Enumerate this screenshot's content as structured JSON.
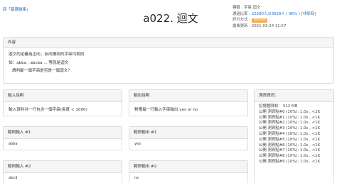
{
  "breadcrumb": {
    "link": "回「基礎題庫」"
  },
  "problem": {
    "title": "a022. 迴文"
  },
  "meta": {
    "tags_label": "標籤 : ",
    "tags_value": "字串 迴文",
    "pass_label": "通過比率 : ",
    "pass_value": "22580人/23628人 ( 96% ) [非即時]",
    "score_label": "評分方式 : ",
    "score_value": "Tolerant",
    "updated_label": "最後更新 : ",
    "updated_value": "2021-03-24 11:57"
  },
  "content": {
    "heading": "內容",
    "lines": [
      "迴文的定義為正向，反向讀到的字串均相同",
      "如：abba , abcba ... 等就是迴文",
      "請判斷一個字串是否是一個迴文？"
    ]
  },
  "input_desc": {
    "heading": "輸入說明",
    "text": "輸入資料共一行包含一個字串(長度 < 1000)"
  },
  "output_desc": {
    "heading": "輸出說明",
    "text": "對應每一行輸入字串輸出 yes or no"
  },
  "sample_input_1": {
    "heading": "範例輸入 #1",
    "text": "abba"
  },
  "sample_output_1": {
    "heading": "範例輸出 #1",
    "text": "yes"
  },
  "sample_input_2": {
    "heading": "範例輸入 #2",
    "text": "abcd"
  },
  "sample_output_2": {
    "heading": "範例輸出 #2",
    "text": "no"
  },
  "test_info": {
    "heading": "測資資訊：",
    "memory": "記憶體限制： 512 MB",
    "cases": [
      "公開 測資點#0 (10%): 1.0s , <1K",
      "公開 測資點#1 (10%): 1.0s , <1K",
      "公開 測資點#2 (10%): 1.0s , <1K",
      "公開 測資點#3 (10%): 1.0s , <1K",
      "公開 測資點#4 (10%): 1.0s , <1K",
      "公開 測資點#5 (10%): 1.0s , <1K",
      "公開 測資點#6 (10%): 1.0s , <1K",
      "公開 測資點#7 (10%): 1.0s , <1K",
      "公開 測資點#8 (10%): 1.0s , <1K",
      "公開 測資點#9 (10%): 1.0s , <1K"
    ]
  }
}
